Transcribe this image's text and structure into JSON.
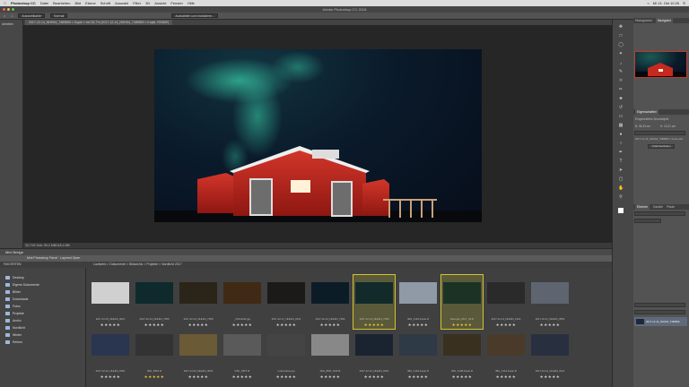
{
  "menubar": {
    "app": "Photoshop CC",
    "items": [
      "Datei",
      "Bearbeiten",
      "Bild",
      "Ebene",
      "Schrift",
      "Auswahl",
      "Filter",
      "3D",
      "Ansicht",
      "Fenster",
      "Hilfe"
    ],
    "clock": "Mi 13. Okt 10:26"
  },
  "window": {
    "title": "Adobe Photoshop CC 2018"
  },
  "options": {
    "tool": "Auswahlkante",
    "mode": "Normal",
    "button": "Auswählen und maskieren..."
  },
  "document": {
    "tab": "2017-12-14_NHH04_7489899 × Kopie × bei 33,7% (2017-12-14_NHH04_7489899 × Kopie, RGB/8*)",
    "status": "33,74%   Dok: 59,2 MB/118,4 MB",
    "left_label": "Arbeiten"
  },
  "panels": {
    "top_tabs": [
      "Histogramm",
      "Navigator"
    ],
    "props_title": "Eigenschaften",
    "props_sub": "Eingebettetes Smartobjekt",
    "w_value": "B: 36,33 cm",
    "h_value": "H: 24,21 cm",
    "layer_file": "2017-12-14_NHH04_7489899 × Kopie.psb",
    "edit_button": "Inhalt bearbeiten",
    "layers_tabs": [
      "Ebenen",
      "Kanäle",
      "Pfade"
    ],
    "layer_name": "2017-12-14_NHH04_7489899"
  },
  "bridge": {
    "title": "Mini Bridge",
    "bar": "Mini Photoshop Panel · Layered Open",
    "path": "Laufwerk > Dokumente > Bildarchiv > Projekte > Nordlicht 2017",
    "favorites_title": "FAVORITEN",
    "favorites": [
      "Desktop",
      "Eigene Dokumente",
      "Bilder",
      "Downloads",
      "Fotos",
      "Projekte",
      "Archiv",
      "Nordlicht",
      "Winter",
      "Reisen"
    ],
    "thumbs_row1": [
      {
        "caption": "2017-11-15_NHH04_0021",
        "stars": "★★★★★",
        "gold": false
      },
      {
        "caption": "2017-12-14_NHH04_7489",
        "stars": "★★★★★",
        "gold": false
      },
      {
        "caption": "2017-12-14_NHH04_7488",
        "stars": "★★★★★",
        "gold": false
      },
      {
        "caption": "_DSC4411.jpg",
        "stars": "★★★★★",
        "gold": false
      },
      {
        "caption": "2017-12-17_NHH04_0431",
        "stars": "★★★★★",
        "gold": false
      },
      {
        "caption": "2017-12-14_NHH04_7482",
        "stars": "★★★★★",
        "gold": false
      },
      {
        "caption": "2017-12-14_NHH04_7489",
        "stars": "★★★★★",
        "gold": true
      },
      {
        "caption": "IMG_4126-Kopie.tif",
        "stars": "★★★★★",
        "gold": false
      },
      {
        "caption": "Eisvogel_2017_03.tif",
        "stars": "★★★★★",
        "gold": true
      },
      {
        "caption": "2017-12-14_NHH04_0102",
        "stars": "★★★★★",
        "gold": false
      },
      {
        "caption": "2017-10-11_NHH04_0553",
        "stars": "★★★★★",
        "gold": false
      }
    ],
    "thumbs_row2": [
      {
        "caption": "2017-12-22_NHH04_0001",
        "stars": "★★★★★",
        "gold": false
      },
      {
        "caption": "IMG_6516.tif",
        "stars": "★★★★★",
        "gold": true
      },
      {
        "caption": "2017-11-04_NHH04_0031",
        "stars": "★★★★★",
        "gold": false
      },
      {
        "caption": "DSC_0871.tif",
        "stars": "★★★★★",
        "gold": false
      },
      {
        "caption": "Lokomotive.jpg",
        "stars": "★★★★★",
        "gold": false
      },
      {
        "caption": "IMG_8031_S/W.tif",
        "stars": "★★★★★",
        "gold": false
      },
      {
        "caption": "2017-12-14_NHH04_0041",
        "stars": "★★★★★",
        "gold": false
      },
      {
        "caption": "IMG_4104-Kopie.tif",
        "stars": "★★★★★",
        "gold": false
      },
      {
        "caption": "IMG_4108-Kopie.tif",
        "stars": "★★★★★",
        "gold": false
      },
      {
        "caption": "IMG_4113-Kopie.tif",
        "stars": "★★★★★",
        "gold": false
      },
      {
        "caption": "2017-12-14_NHH04_0111",
        "stars": "★★★★★",
        "gold": false
      }
    ]
  },
  "colors": {
    "accent_gold": "#e8c22e",
    "selection": "#d4c233",
    "aurora": "#2bd3a6",
    "house": "#b3231e"
  }
}
